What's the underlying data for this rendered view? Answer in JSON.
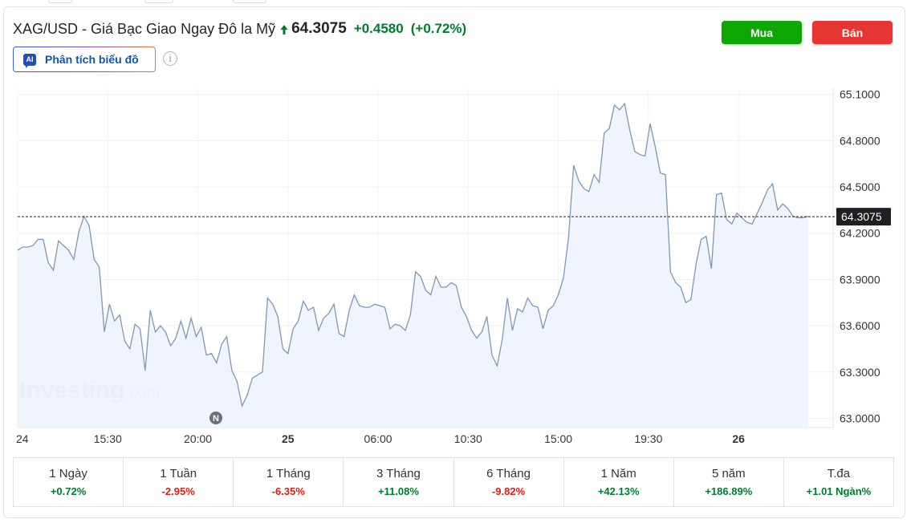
{
  "header": {
    "title": "XAG/USD - Giá Bạc Giao Ngay Đô la Mỹ",
    "price": "64.3075",
    "change": "+0.4580",
    "change_pct": "(+0.72%)",
    "buy_label": "Mua",
    "sell_label": "Bán",
    "ai_badge": "AI",
    "ai_label": "Phân tích biểu đồ",
    "info_glyph": "i"
  },
  "colors": {
    "positive": "#007c32",
    "negative": "#d91e18",
    "buy": "#0ea600",
    "sell": "#e63631",
    "line": "#7f97b2",
    "area": "#eef3fc"
  },
  "chart_data": {
    "type": "area",
    "title": "",
    "xlabel": "",
    "ylabel": "",
    "ylim": [
      62.94,
      65.14
    ],
    "y_ticks": [
      "65.1000",
      "64.8000",
      "64.5000",
      "64.2000",
      "63.9000",
      "63.6000",
      "63.3000",
      "63.0000"
    ],
    "x_ticks": [
      {
        "label": "24",
        "bold": false
      },
      {
        "label": "15:30",
        "bold": false
      },
      {
        "label": "20:00",
        "bold": false
      },
      {
        "label": "25",
        "bold": true
      },
      {
        "label": "06:00",
        "bold": false
      },
      {
        "label": "10:30",
        "bold": false
      },
      {
        "label": "15:00",
        "bold": false
      },
      {
        "label": "19:30",
        "bold": false
      },
      {
        "label": "26",
        "bold": true
      }
    ],
    "current_price_label": "64.3075",
    "current_price": 64.3075,
    "watermark": "Investing.com",
    "news_marker": "N",
    "series": [
      {
        "values": [
          64.09,
          64.11,
          64.11,
          64.12,
          64.16,
          64.16,
          64.01,
          63.96,
          64.15,
          64.12,
          64.09,
          64.03,
          64.21,
          64.31,
          64.25,
          64.03,
          63.98,
          63.56,
          63.74,
          63.63,
          63.67,
          63.5,
          63.45,
          63.61,
          63.58,
          63.31,
          63.7,
          63.56,
          63.6,
          63.56,
          63.47,
          63.52,
          63.63,
          63.52,
          63.65,
          63.53,
          63.59,
          63.41,
          63.42,
          63.36,
          63.48,
          63.53,
          63.31,
          63.24,
          63.08,
          63.15,
          63.26,
          63.28,
          63.3,
          63.78,
          63.74,
          63.66,
          63.45,
          63.42,
          63.58,
          63.63,
          63.76,
          63.7,
          63.72,
          63.57,
          63.65,
          63.68,
          63.74,
          63.55,
          63.53,
          63.7,
          63.8,
          63.73,
          63.72,
          63.72,
          63.74,
          63.73,
          63.72,
          63.58,
          63.61,
          63.6,
          63.57,
          63.67,
          63.95,
          63.92,
          63.83,
          63.8,
          63.92,
          63.85,
          63.85,
          63.88,
          63.86,
          63.72,
          63.66,
          63.57,
          63.52,
          63.56,
          63.66,
          63.41,
          63.34,
          63.51,
          63.78,
          63.57,
          63.71,
          63.69,
          63.78,
          63.73,
          63.72,
          63.58,
          63.7,
          63.73,
          63.8,
          63.91,
          64.17,
          64.64,
          64.54,
          64.49,
          64.47,
          64.58,
          64.53,
          64.85,
          64.88,
          65.03,
          65.0,
          65.04,
          64.87,
          64.73,
          64.71,
          64.7,
          64.91,
          64.76,
          64.59,
          64.58,
          63.95,
          63.88,
          63.85,
          63.75,
          63.77,
          64.0,
          64.16,
          64.18,
          63.97,
          64.45,
          64.46,
          64.29,
          64.26,
          64.33,
          64.3,
          64.27,
          64.26,
          64.33,
          64.4,
          64.48,
          64.52,
          64.35,
          64.39,
          64.36,
          64.31,
          64.3,
          64.3,
          64.31
        ]
      }
    ]
  },
  "periods": [
    {
      "label": "1 Ngày",
      "value": "+0.72%",
      "dir": "pos"
    },
    {
      "label": "1 Tuần",
      "value": "-2.95%",
      "dir": "neg"
    },
    {
      "label": "1 Tháng",
      "value": "-6.35%",
      "dir": "neg"
    },
    {
      "label": "3 Tháng",
      "value": "+11.08%",
      "dir": "pos"
    },
    {
      "label": "6 Tháng",
      "value": "-9.82%",
      "dir": "neg"
    },
    {
      "label": "1 Năm",
      "value": "+42.13%",
      "dir": "pos"
    },
    {
      "label": "5 năm",
      "value": "+186.89%",
      "dir": "pos"
    },
    {
      "label": "T.đa",
      "value": "+1.01 Ngàn%",
      "dir": "pos"
    }
  ]
}
